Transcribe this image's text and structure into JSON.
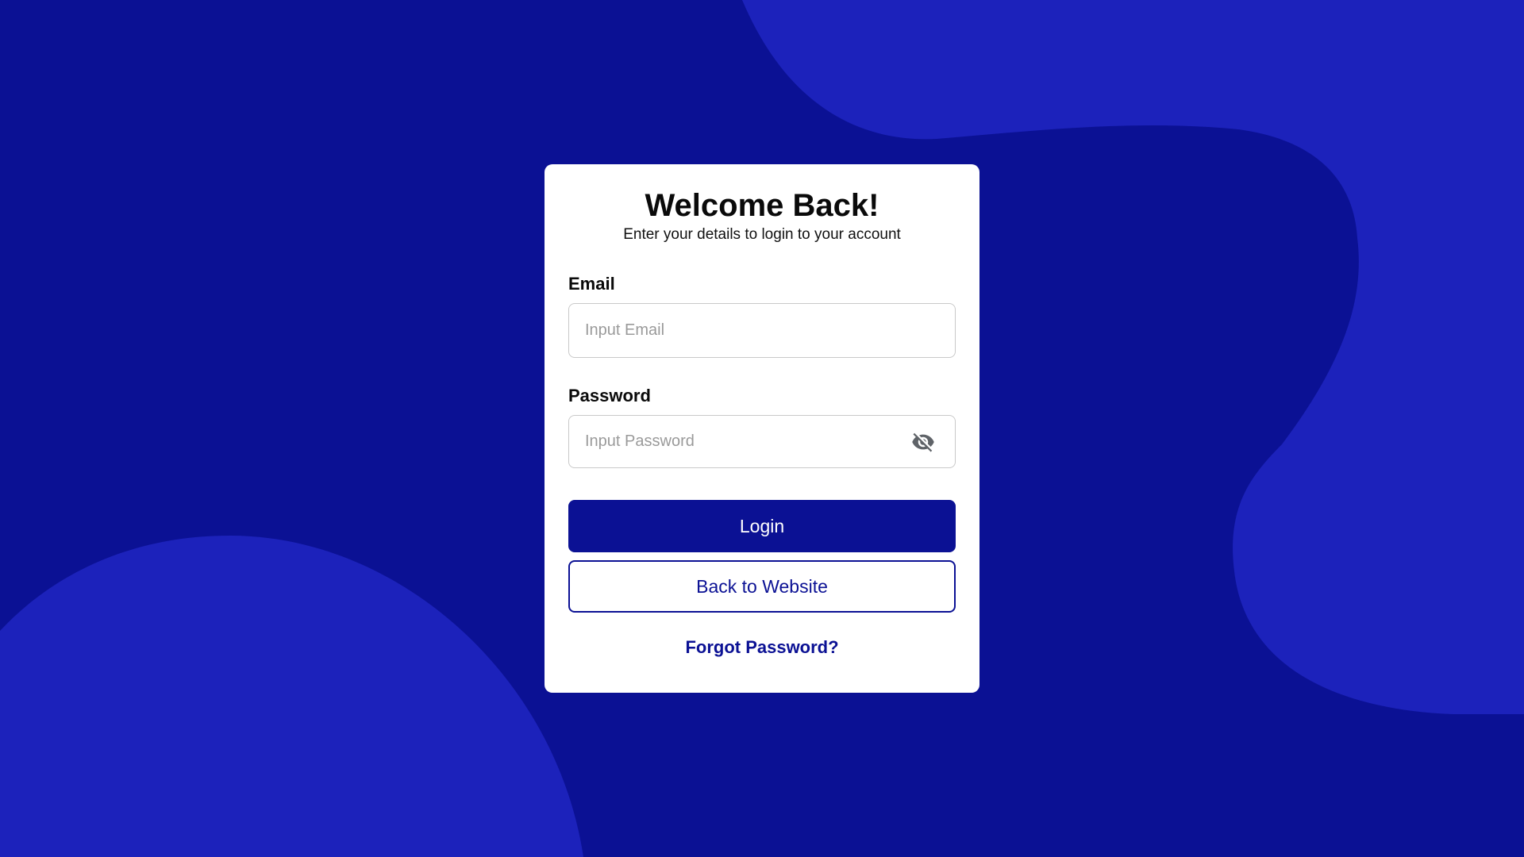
{
  "colors": {
    "background": "#0b1194",
    "background_blob": "#1c22bb",
    "card": "#ffffff",
    "accent": "#0b1194"
  },
  "card": {
    "title": "Welcome Back!",
    "subtitle": "Enter your details to login to your account"
  },
  "email": {
    "label": "Email",
    "placeholder": "Input Email",
    "value": ""
  },
  "password": {
    "label": "Password",
    "placeholder": "Input Password",
    "value": "",
    "visibility_icon": "eye-slash-icon"
  },
  "buttons": {
    "login": "Login",
    "back_to_website": "Back to Website"
  },
  "links": {
    "forgot_password": "Forgot Password?"
  }
}
